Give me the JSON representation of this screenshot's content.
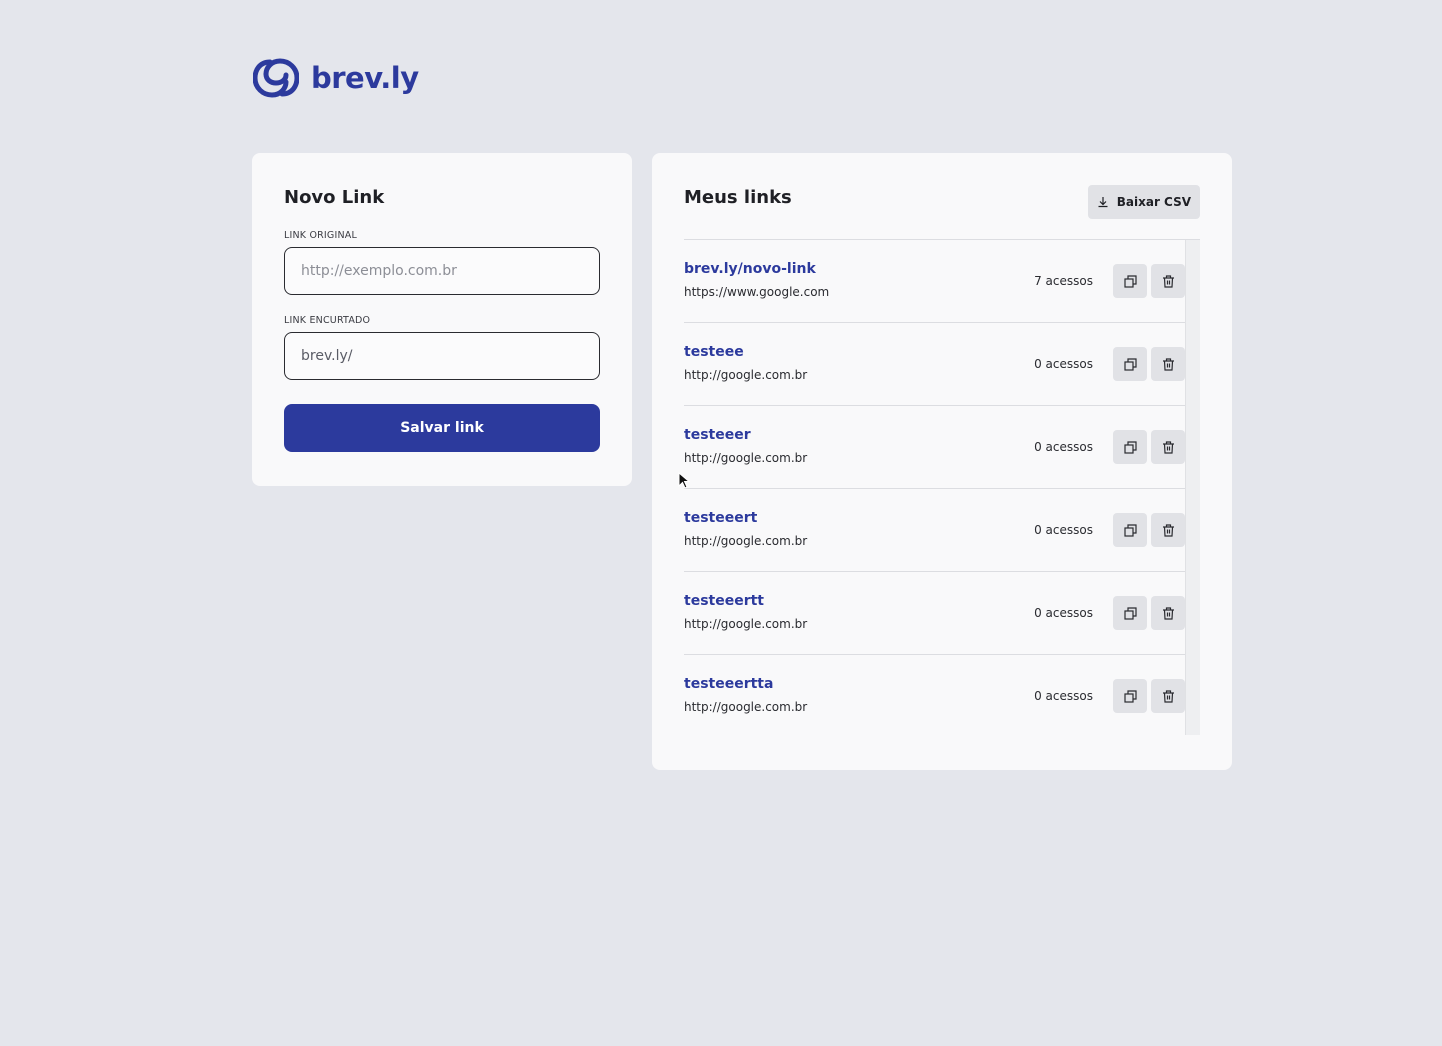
{
  "brand": {
    "name": "brev.ly",
    "color": "#2c3a9d"
  },
  "new_link": {
    "title": "Novo Link",
    "original_label": "LINK ORIGINAL",
    "original_placeholder": "http://exemplo.com.br",
    "short_label": "LINK ENCURTADO",
    "short_placeholder": "brev.ly/",
    "save_label": "Salvar link"
  },
  "my_links": {
    "title": "Meus links",
    "csv_label": "Baixar CSV",
    "csv_icon": "download-icon",
    "copy_icon": "copy-icon",
    "delete_icon": "trash-icon",
    "items": [
      {
        "short": "brev.ly/novo-link",
        "original": "https://www.google.com",
        "hits": "7 acessos"
      },
      {
        "short": "testeee",
        "original": "http://google.com.br",
        "hits": "0 acessos"
      },
      {
        "short": "testeeer",
        "original": "http://google.com.br",
        "hits": "0 acessos"
      },
      {
        "short": "testeeert",
        "original": "http://google.com.br",
        "hits": "0 acessos"
      },
      {
        "short": "testeeertt",
        "original": "http://google.com.br",
        "hits": "0 acessos"
      },
      {
        "short": "testeeertta",
        "original": "http://google.com.br",
        "hits": "0 acessos"
      }
    ]
  }
}
